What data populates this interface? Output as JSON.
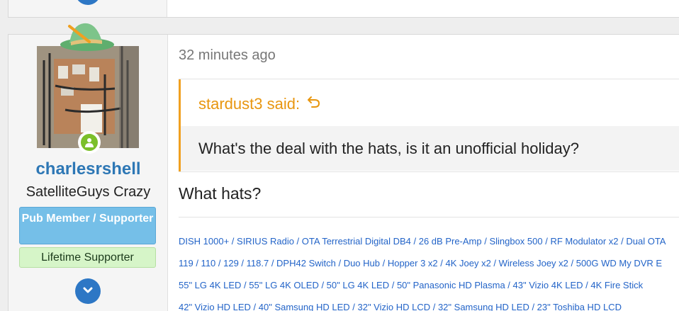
{
  "post": {
    "time": "32 minutes ago",
    "username": "charlesrshell",
    "user_title": "SatelliteGuys Crazy",
    "banners": {
      "pub": "Pub Member / Supporter",
      "lifetime": "Lifetime Supporter"
    },
    "quote": {
      "attribution": "stardust3 said:",
      "body": "What's the deal with the hats, is it an unofficial holiday?"
    },
    "reply": "What hats?",
    "signature": [
      "DISH 1000+ / SIRIUS Radio / OTA Terrestrial Digital DB4 / 26 dB Pre-Amp / Slingbox 500 / RF Modulator x2 / Dual OTA",
      "119 / 110 / 129 / 118.7 / DPH42 Switch / Duo Hub / Hopper 3 x2 / 4K Joey x2 / Wireless Joey x2 / 500G WD My DVR E",
      "55\" LG 4K LED / 55\" LG 4K OLED / 50\" LG 4K LED / 50\" Panasonic HD Plasma / 43\" Vizio 4K LED / 4K Fire Stick",
      "42\" Vizio HD LED / 40\" Samsung HD LED / 32\" Vizio HD LCD / 32\" Samsung HD LED / 23\" Toshiba HD LCD"
    ]
  },
  "colors": {
    "username": "#2d77b5",
    "quote_accent": "#f0a020",
    "pub_banner": "#75bfe8",
    "lifetime_banner": "#d6f5c8",
    "signature_link": "#2364c8",
    "button": "#2d77c5"
  },
  "icons": [
    "chevron-down-icon",
    "reply-arrow-icon",
    "online-person-icon",
    "hat-icon"
  ]
}
